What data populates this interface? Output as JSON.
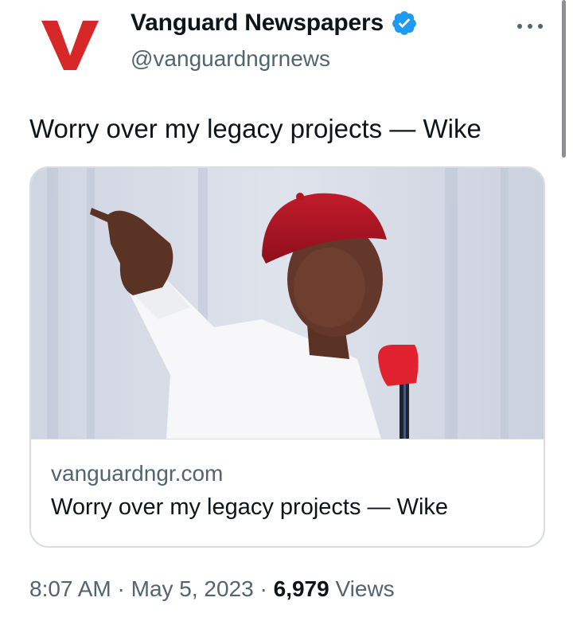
{
  "account": {
    "name": "Vanguard Newspapers",
    "handle": "@vanguardngrnews",
    "avatar_letter": "V",
    "brand_color": "#d62828",
    "verified_color": "#1d9bf0"
  },
  "tweet": {
    "text": "Worry over my legacy projects — Wike"
  },
  "card": {
    "domain": "vanguardngr.com",
    "title": "Worry over my legacy projects — Wike",
    "image_subject": "man in red cap pointing while speaking into microphone"
  },
  "meta": {
    "time": "8:07 AM",
    "separator1": "·",
    "date": "May 5, 2023",
    "separator2": "·",
    "views_count": "6,979",
    "views_label": "Views"
  },
  "icons": {
    "more": "more-options-icon",
    "verified": "verified-badge-icon"
  }
}
